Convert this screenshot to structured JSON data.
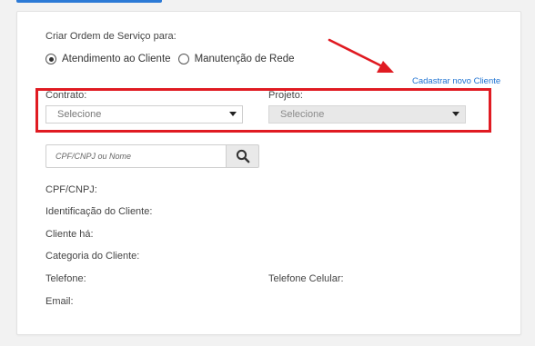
{
  "form": {
    "heading": "Criar Ordem de Serviço para:",
    "radio_options": [
      {
        "label": "Atendimento ao Cliente",
        "selected": true
      },
      {
        "label": "Manutenção de Rede",
        "selected": false
      }
    ],
    "register_link": "Cadastrar novo Cliente",
    "contract": {
      "label": "Contrato:",
      "value": "Selecione"
    },
    "project": {
      "label": "Projeto:",
      "value": "Selecione",
      "disabled": true
    },
    "search": {
      "placeholder": "CPF/CNPJ ou Nome",
      "icon": "search-icon"
    },
    "client_info": {
      "cpf_cnpj": "CPF/CNPJ:",
      "identification": "Identificação do Cliente:",
      "client_since": "Cliente há:",
      "category": "Categoria do Cliente:",
      "phone": "Telefone:",
      "mobile_phone": "Telefone Celular:",
      "email": "Email:"
    }
  },
  "colors": {
    "accent": "#1f73d2",
    "annotation": "#e01b22",
    "tab_underline": "#2c7ad6"
  }
}
